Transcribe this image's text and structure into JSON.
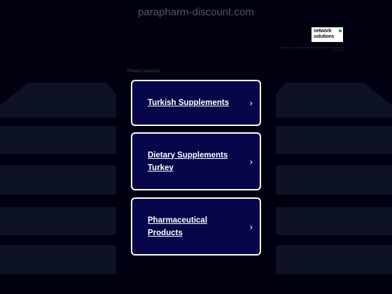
{
  "header": {
    "domain": "parapharm-discount.com"
  },
  "sponsor": {
    "logo_line1": "network",
    "logo_line2": "solutions",
    "note": "This Page is provided courtesy of Network Solutions. The domain may be for sale."
  },
  "related": {
    "heading": "Related searches"
  },
  "links": [
    {
      "label": "Turkish Supplements"
    },
    {
      "label": "Dietary Supplements Turkey"
    },
    {
      "label": "Pharmaceutical Products"
    }
  ],
  "icons": {
    "chevron": "›"
  },
  "colors": {
    "background": "#000010",
    "card": "#07064a",
    "border": "#ffffff"
  }
}
